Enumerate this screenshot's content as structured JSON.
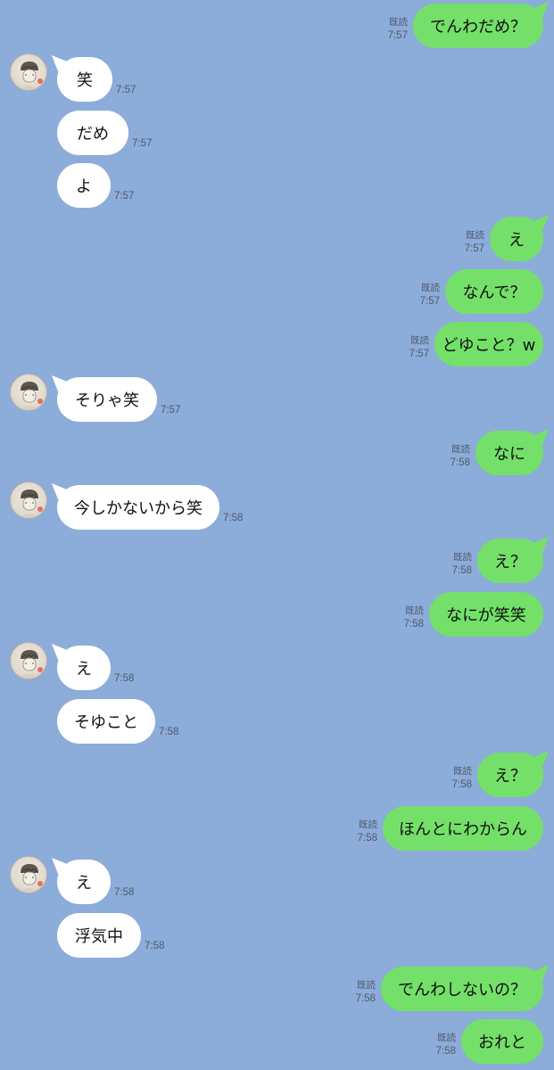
{
  "chat": {
    "read_label": "既読",
    "messages": [
      {
        "side": "out",
        "text": "でんわだめ？",
        "time": "7:57",
        "read": true
      },
      {
        "side": "in",
        "text": "笑",
        "time": "7:57",
        "avatar": true
      },
      {
        "side": "in",
        "text": "だめ",
        "time": "7:57"
      },
      {
        "side": "in",
        "text": "よ",
        "time": "7:57"
      },
      {
        "side": "out",
        "text": "え",
        "time": "7:57",
        "read": true
      },
      {
        "side": "out",
        "text": "なんで？",
        "time": "7:57",
        "read": true
      },
      {
        "side": "out",
        "text": "どゆこと？w",
        "time": "7:57",
        "read": true
      },
      {
        "side": "in",
        "text": "そりゃ笑",
        "time": "7:57",
        "avatar": true
      },
      {
        "side": "out",
        "text": "なに",
        "time": "7:58",
        "read": true
      },
      {
        "side": "in",
        "text": "今しかないから笑",
        "time": "7:58",
        "avatar": true
      },
      {
        "side": "out",
        "text": "え？",
        "time": "7:58",
        "read": true
      },
      {
        "side": "out",
        "text": "なにが笑笑",
        "time": "7:58",
        "read": true
      },
      {
        "side": "in",
        "text": "え",
        "time": "7:58",
        "avatar": true
      },
      {
        "side": "in",
        "text": "そゆこと",
        "time": "7:58"
      },
      {
        "side": "out",
        "text": "え？",
        "time": "7:58",
        "read": true
      },
      {
        "side": "out",
        "text": "ほんとにわからん",
        "time": "7:58",
        "read": true
      },
      {
        "side": "in",
        "text": "え",
        "time": "7:58",
        "avatar": true
      },
      {
        "side": "in",
        "text": "浮気中",
        "time": "7:58"
      },
      {
        "side": "out",
        "text": "でんわしないの？",
        "time": "7:58",
        "read": true
      },
      {
        "side": "out",
        "text": "おれと",
        "time": "7:58",
        "read": true
      }
    ]
  },
  "colors": {
    "background": "#8cacd9",
    "outgoing_bubble": "#74e069",
    "incoming_bubble": "#ffffff",
    "meta_text": "#4f5a6b"
  }
}
